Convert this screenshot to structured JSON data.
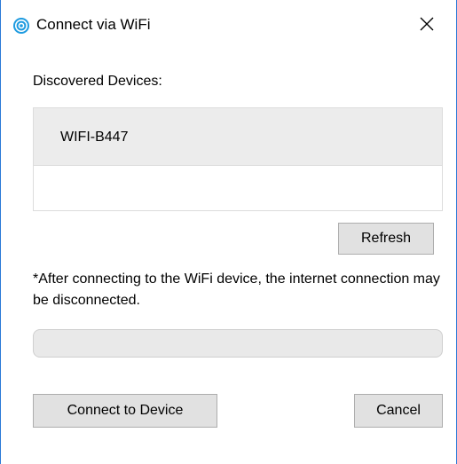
{
  "window": {
    "title": "Connect via WiFi",
    "icon": "wifi-app-icon",
    "close_icon": "close-icon",
    "border_color": "#2b79d8"
  },
  "devices": {
    "label": "Discovered Devices:",
    "items": [
      {
        "label": "WIFI-B447",
        "selected": true
      }
    ]
  },
  "buttons": {
    "refresh": "Refresh",
    "connect": "Connect to Device",
    "cancel": "Cancel"
  },
  "note": "*After connecting to the WiFi device, the internet connection may be disconnected.",
  "progress": {
    "value": 0
  },
  "colors": {
    "selection_bg": "#ececec",
    "button_bg": "#e1e1e1",
    "button_border": "#adadad",
    "app_icon": "#1e9be0"
  }
}
